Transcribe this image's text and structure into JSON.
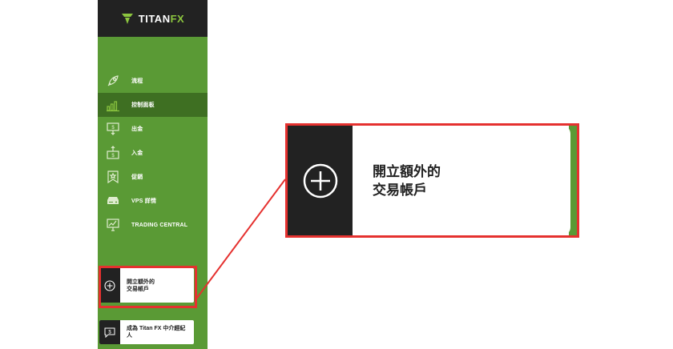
{
  "brand": {
    "logo_main": "TITAN",
    "logo_fx": "FX"
  },
  "nav": {
    "items": [
      {
        "label": "流程",
        "icon": "rocket-icon",
        "active": false
      },
      {
        "label": "控制面板",
        "icon": "bar-chart-icon",
        "active": true
      },
      {
        "label": "出金",
        "icon": "withdraw-icon",
        "active": false
      },
      {
        "label": "入金",
        "icon": "deposit-icon",
        "active": false
      },
      {
        "label": "促銷",
        "icon": "promo-badge-icon",
        "active": false
      },
      {
        "label": "VPS 詳情",
        "icon": "server-icon",
        "active": false
      },
      {
        "label": "TRADING CENTRAL",
        "icon": "monitor-chart-icon",
        "active": false
      }
    ]
  },
  "open_account": {
    "line1": "開立額外的",
    "line2": "交易帳戶",
    "icon": "plus-circle-icon"
  },
  "ib": {
    "line1": "成為 Titan FX 中介經紀",
    "line2": "人",
    "icon": "dollar-chat-icon"
  },
  "callout": {
    "line1": "開立額外的",
    "line2": "交易帳戶"
  },
  "colors": {
    "sidebar_green": "#5a9a35",
    "active_green": "#3e6f22",
    "dark": "#222222",
    "highlight_red": "#e5312f"
  }
}
